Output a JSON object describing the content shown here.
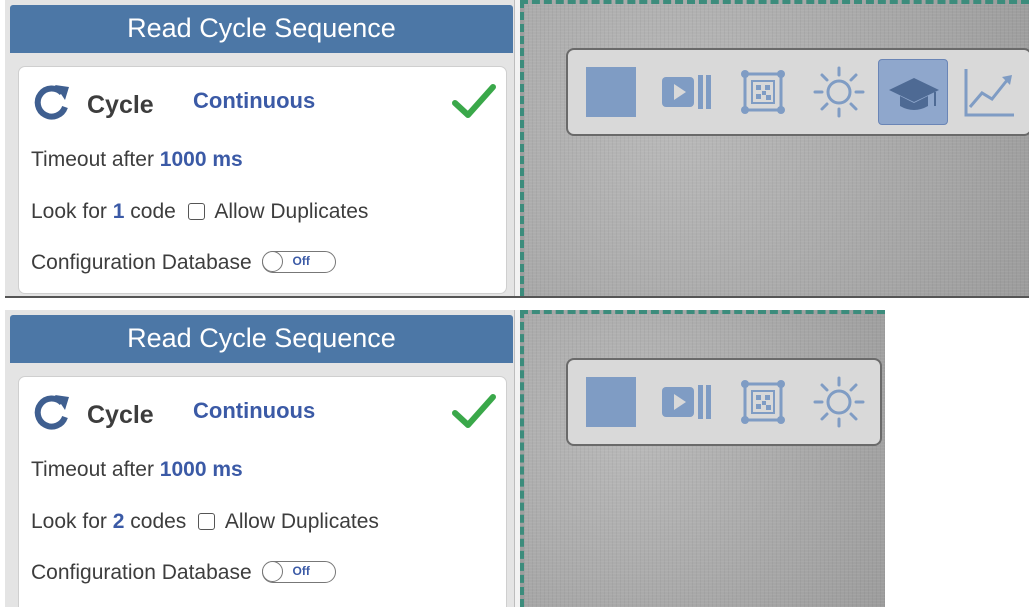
{
  "colors": {
    "header_bg": "#4c77a6",
    "value_text": "#3b5aa6",
    "check_green": "#3aa84a",
    "icon_blue": "#7f9cc4"
  },
  "screens": [
    {
      "header_title": "Read Cycle Sequence",
      "cycle_label": "Cycle",
      "cycle_mode": "Continuous",
      "timeout_prefix": "Timeout after",
      "timeout_value": "1000 ms",
      "look_prefix": "Look for",
      "code_count": "1",
      "code_unit": "code",
      "allow_duplicates_label": "Allow Duplicates",
      "config_db_label": "Configuration Database",
      "toggle_state": "Off",
      "toolbar_icons": [
        "stop-icon",
        "video-camera-icon",
        "barcode-icon",
        "light-icon",
        "training-cap-icon",
        "chart-icon"
      ],
      "active_tool": "training-cap-icon"
    },
    {
      "header_title": "Read Cycle Sequence",
      "cycle_label": "Cycle",
      "cycle_mode": "Continuous",
      "timeout_prefix": "Timeout after",
      "timeout_value": "1000 ms",
      "look_prefix": "Look for",
      "code_count": "2",
      "code_unit": "codes",
      "allow_duplicates_label": "Allow Duplicates",
      "config_db_label": "Configuration Database",
      "toggle_state": "Off",
      "toolbar_icons": [
        "stop-icon",
        "video-camera-icon",
        "barcode-icon",
        "light-icon"
      ],
      "active_tool": ""
    }
  ]
}
